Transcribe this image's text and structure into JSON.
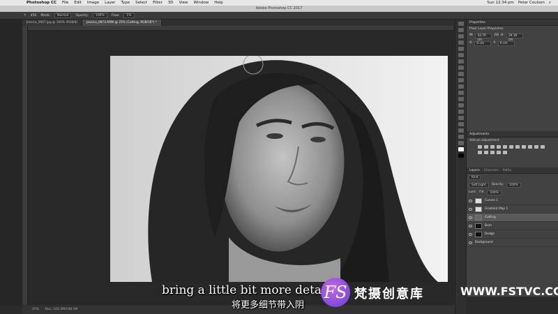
{
  "menubar": {
    "app": "Photoshop CC",
    "items": [
      "File",
      "Edit",
      "Image",
      "Layer",
      "Type",
      "Select",
      "Filter",
      "3D",
      "View",
      "Window",
      "Help"
    ],
    "clock": "Sun 12:34 pm",
    "user": "Peter Coulson"
  },
  "window": {
    "title": "Adobe Photoshop CC 2017"
  },
  "options": {
    "mode_label": "Mode:",
    "mode_value": "Normal",
    "opacity_label": "Opacity:",
    "opacity_value": "100%",
    "flow_label": "Flow:",
    "flow_value": "1%",
    "brush_size": "450"
  },
  "tabs": [
    {
      "label": "Jessica_0907.jpg @ 100% (RGB/8)",
      "active": false
    },
    {
      "label": "Jessica_0873.ARW @ 25% (Cutting, RGB/16*) *",
      "active": true
    }
  ],
  "status": {
    "zoom": "25%",
    "doc": "Doc: 103.3M/148.1M"
  },
  "properties": {
    "tab": "Properties",
    "subtitle": "Pixel Layer Properties",
    "w_label": "W:",
    "w_value": "43.76 cm",
    "h_label": "H:",
    "h_value": "29.18 cm",
    "go_label": "GO",
    "x_label": "X:",
    "x_value": "0 cm",
    "y_label": "Y:",
    "y_value": "0 cm"
  },
  "adjustments": {
    "tab": "Adjustments",
    "subtitle": "Add an adjustment"
  },
  "layers": {
    "tabs": [
      "Layers",
      "Channels",
      "Paths"
    ],
    "kind_label": "Kind",
    "blend_mode": "Soft Light",
    "opacity_label": "Opacity:",
    "opacity_value": "100%",
    "lock_label": "Lock:",
    "fill_label": "Fill:",
    "fill_value": "100%",
    "items": [
      {
        "name": "Curves 1",
        "thumb": "white",
        "selected": false
      },
      {
        "name": "Gradient Map 1",
        "thumb": "white",
        "selected": false
      },
      {
        "name": "Cutting",
        "thumb": "gray",
        "selected": true
      },
      {
        "name": "Burn",
        "thumb": "black",
        "selected": false
      },
      {
        "name": "Dodge",
        "thumb": "black",
        "selected": false
      },
      {
        "name": "Background",
        "thumb": "photo",
        "selected": false
      }
    ]
  },
  "subtitles": {
    "en": "bring a little bit more detail ir",
    "cn": "将更多细节带入阴"
  },
  "watermark": {
    "logo": "FS",
    "brand": "梵摄创意库",
    "url": "WWW.FSTVC.CC"
  },
  "colors": {
    "panel_bg": "#424242",
    "workspace": "#282828",
    "selected_layer": "#5a5a5a"
  }
}
